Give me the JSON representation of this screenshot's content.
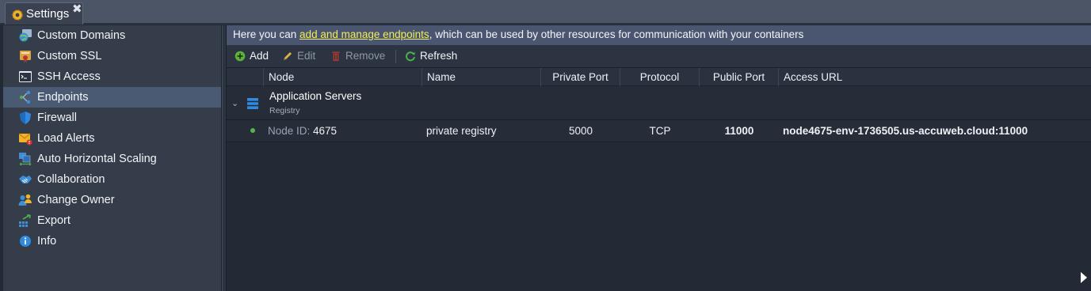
{
  "tab": {
    "title": "Settings",
    "close": "✖"
  },
  "sidebar": {
    "items": [
      {
        "label": "Custom Domains",
        "icon": "globe-icon"
      },
      {
        "label": "Custom SSL",
        "icon": "ssl-certificate-icon"
      },
      {
        "label": "SSH Access",
        "icon": "terminal-icon"
      },
      {
        "label": "Endpoints",
        "icon": "endpoints-icon",
        "active": true
      },
      {
        "label": "Firewall",
        "icon": "shield-icon"
      },
      {
        "label": "Load Alerts",
        "icon": "alert-envelope-icon"
      },
      {
        "label": "Auto Horizontal Scaling",
        "icon": "scaling-icon"
      },
      {
        "label": "Collaboration",
        "icon": "handshake-icon"
      },
      {
        "label": "Change Owner",
        "icon": "users-icon"
      },
      {
        "label": "Export",
        "icon": "export-icon"
      },
      {
        "label": "Info",
        "icon": "info-icon"
      }
    ]
  },
  "info": {
    "prefix": "Here you can ",
    "link": "add and manage endpoints",
    "suffix": ", which can be used by other resources for communication with your containers"
  },
  "toolbar": {
    "add": "Add",
    "edit": "Edit",
    "remove": "Remove",
    "refresh": "Refresh"
  },
  "columns": {
    "node": "Node",
    "name": "Name",
    "private_port": "Private Port",
    "protocol": "Protocol",
    "public_port": "Public Port",
    "access_url": "Access URL"
  },
  "group": {
    "title": "Application Servers",
    "subtitle": "Registry",
    "expand": "⌄"
  },
  "row": {
    "node_prefix": "Node ID: ",
    "node_id": "4675",
    "name": "private registry",
    "private_port": "5000",
    "protocol": "TCP",
    "public_port": "11000",
    "access_url": "node4675-env-1736505.us-accuweb.cloud:11000"
  },
  "colors": {
    "active": "#4a5a72",
    "info_bar": "#4a5670",
    "link": "#f2ec5a",
    "status_ok": "#58b34a",
    "add": "#5cb338",
    "remove": "#c0392b",
    "refresh": "#4caf50"
  }
}
